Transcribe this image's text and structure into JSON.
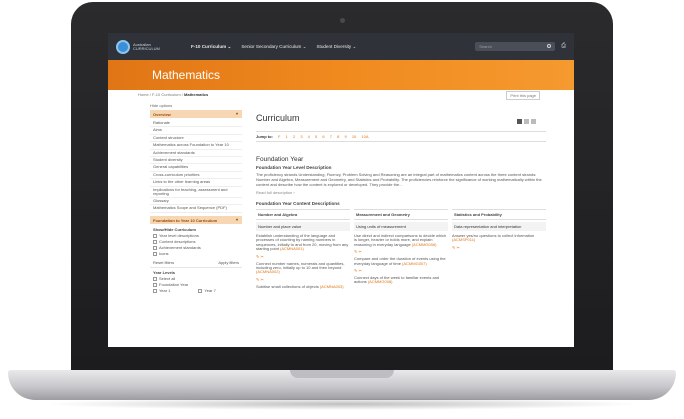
{
  "logo": {
    "line1": "Australian",
    "line2": "CURRICULUM"
  },
  "nav": {
    "items": [
      "F-10 Curriculum ⌄",
      "Senior Secondary Curriculum ⌄",
      "Student Diversity ⌄"
    ],
    "search_placeholder": "Search"
  },
  "banner": {
    "title": "Mathematics"
  },
  "breadcrumb": {
    "home": "Home",
    "sep": " / ",
    "f10": "F-10 Curriculum",
    "current": "Mathematics"
  },
  "print_label": "Print this page",
  "sidebar": {
    "hide_options": "Hide options",
    "overview_head": "Overview",
    "items": [
      "Rationale",
      "Aims",
      "Content structure",
      "Mathematics across Foundation to Year 10",
      "Achievement standards",
      "Student diversity",
      "General capabilities",
      "Cross-curriculum priorities",
      "Links to the other learning areas",
      "Implications for teaching, assessment and reporting",
      "Glossary",
      "Mathematics Scope and Sequence (PDF)"
    ],
    "f10_head": "Foundation to Year 10 Curriculum",
    "show_hide": "Show/Hide Curriculum",
    "checks": [
      "Year level descriptions",
      "Content descriptions",
      "Achievement standards",
      "Icons"
    ],
    "reset": "Reset filters",
    "apply": "Apply filters",
    "year_levels": "Year Levels",
    "year_checks": [
      "Select all",
      "Foundation Year",
      "Year 1",
      "Year 7"
    ]
  },
  "main": {
    "title": "Curriculum",
    "jump_label": "Jump to:",
    "jump_items": [
      "F",
      "1",
      "2",
      "3",
      "4",
      "5",
      "6",
      "7",
      "8",
      "9",
      "10",
      "10A"
    ],
    "year_title": "Foundation Year",
    "level_desc_title": "Foundation Year Level Description",
    "level_desc_text": "The proficiency strands Understanding, Fluency, Problem Solving and Reasoning are an integral part of mathematics content across the three content strands: Number and Algebra, Measurement and Geometry, and Statistics and Probability. The proficiencies reinforce the significance of working mathematically within the content and describe how the content is explored or developed. They provide the...",
    "read_full": "Read full description ›",
    "content_desc_title": "Foundation Year Content Descriptions",
    "columns": [
      {
        "head": "Number and Algebra",
        "sub": "Number and place value",
        "cells": [
          {
            "text": "Establish understanding of the language and processes of counting by naming numbers in sequences, initially to and from 20, moving from any starting point",
            "code": "(ACMNA001)"
          },
          {
            "text": "Connect number names, numerals and quantities, including zero, initially up to 10 and then beyond",
            "code": "(ACMNA002)"
          },
          {
            "text": "Subitise small collections of objects",
            "code": "(ACMNA003)"
          }
        ]
      },
      {
        "head": "Measurement and Geometry",
        "sub": "Using units of measurement",
        "cells": [
          {
            "text": "Use direct and indirect comparisons to decide which is longer, heavier or holds more, and explain reasoning in everyday language",
            "code": "(ACMMG006)"
          },
          {
            "text": "Compare and order the duration of events using the everyday language of time",
            "code": "(ACMMG007)"
          },
          {
            "text": "Connect days of the week to familiar events and actions",
            "code": "(ACMMG008)"
          }
        ]
      },
      {
        "head": "Statistics and Probability",
        "sub": "Data representation and interpretation",
        "cells": [
          {
            "text": "Answer yes/no questions to collect information",
            "code": "(ACMSP011)"
          }
        ]
      }
    ],
    "tag_icon": "✎ ✂"
  },
  "colors": {
    "nav_bg": "#2f3238",
    "banner": "#f08a1f",
    "accent": "#e07515"
  }
}
